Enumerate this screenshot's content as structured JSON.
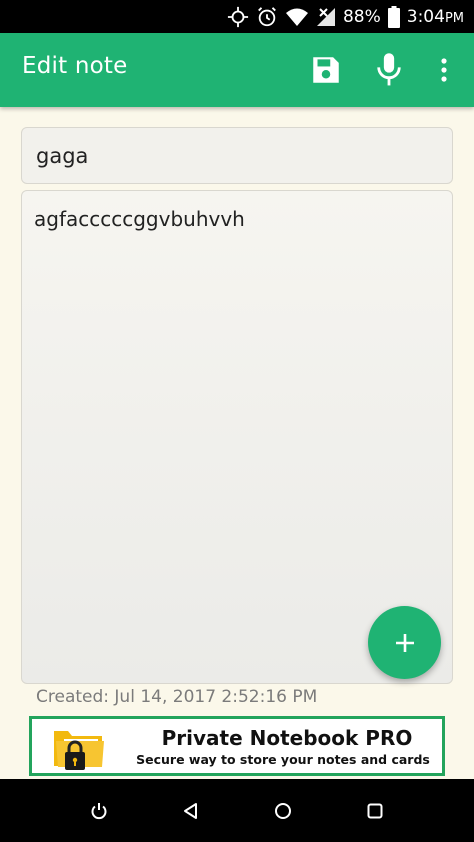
{
  "status_bar": {
    "battery": "88%",
    "time": "3:04",
    "time_suffix": "PM"
  },
  "app_bar": {
    "title": "Edit note",
    "icons": [
      "save-icon",
      "microphone-icon",
      "more-vert-icon"
    ]
  },
  "note": {
    "title": "gaga",
    "body": "agfacccccggvbuhvvh"
  },
  "fab": {
    "icon": "plus-icon"
  },
  "created_text": "Created: Jul 14, 2017 2:52:16 PM",
  "ad": {
    "title": "Private Notebook PRO",
    "subtitle": "Secure way to store your notes and cards"
  },
  "nav_bar": {
    "icons": [
      "power-icon",
      "back-icon",
      "home-icon",
      "recents-icon"
    ]
  },
  "colors": {
    "primary": "#1fb373",
    "background": "#fbf8ea",
    "ad_border": "#23a45c"
  }
}
